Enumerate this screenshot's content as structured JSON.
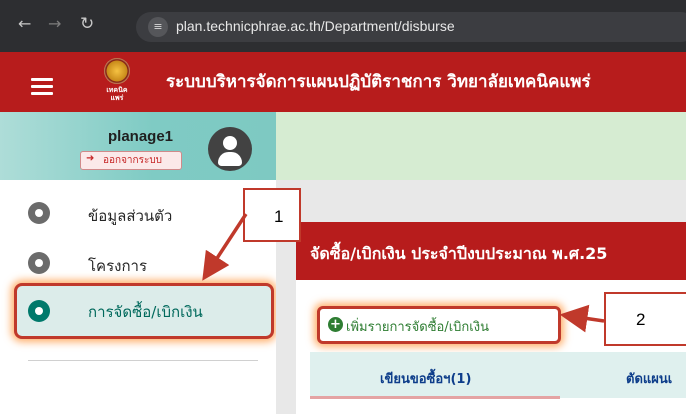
{
  "browser": {
    "back_icon": "arrow-left-icon",
    "forward_icon": "arrow-right-icon",
    "reload_icon": "reload-icon",
    "url": "plan.technicphrae.ac.th/Department/disburse"
  },
  "header": {
    "title": "ระบบบริหารจัดการแผนปฏิบัติราชการ วิทยาลัยเทคนิคแพร่",
    "logo_text": "เทคนิคแพร่"
  },
  "profile": {
    "username": "planage1",
    "logout_label": "ออกจากระบบ"
  },
  "sidebar": {
    "items": [
      {
        "label": "ข้อมูลส่วนตัว"
      },
      {
        "label": "โครงการ"
      },
      {
        "label": "การจัดซื้อ/เบิกเงิน"
      }
    ]
  },
  "main": {
    "card_title": "จัดซื้อ/เบิกเงิน ประจำปีงบประมาณ พ.ศ.25",
    "add_button_label": "เพิ่มรายการจัดซื้อ/เบิกเงิน",
    "tabs": [
      {
        "label": "เขียนขอซื้อฯ(1)"
      },
      {
        "label": "ตัดแผนเ"
      }
    ]
  },
  "annotations": {
    "callout_1": "1",
    "callout_2": "2"
  },
  "colors": {
    "brand_red": "#b71c1c",
    "accent_teal": "#00796b",
    "annotation_red": "#c0392b"
  }
}
